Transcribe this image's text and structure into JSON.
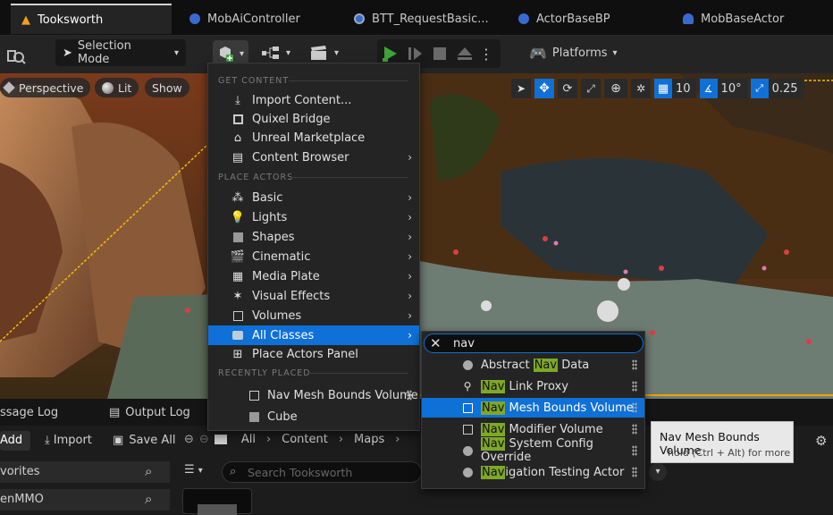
{
  "tabs": [
    {
      "label": "Tooksworth",
      "icon": "unreal-logo-icon"
    },
    {
      "label": "MobAiController",
      "icon": "blueprint-icon"
    },
    {
      "label": "BTT_RequestBasic...",
      "icon": "task-icon"
    },
    {
      "label": "ActorBaseBP",
      "icon": "blueprint-icon"
    },
    {
      "label": "MobBaseActor",
      "icon": "actor-icon"
    }
  ],
  "toolbar": {
    "selection_mode": "Selection Mode",
    "platforms": "Platforms"
  },
  "viewport": {
    "perspective": "Perspective",
    "lit": "Lit",
    "show": "Show",
    "grid_snap": "10",
    "rot_snap": "10°",
    "scale_snap": "0.25"
  },
  "menu": {
    "get_content_header": "GET CONTENT",
    "place_actors_header": "PLACE ACTORS",
    "recently_placed_header": "RECENTLY PLACED",
    "get_content": [
      "Import Content...",
      "Quixel Bridge",
      "Unreal Marketplace",
      "Content Browser"
    ],
    "place_actors": [
      "Basic",
      "Lights",
      "Shapes",
      "Cinematic",
      "Media Plate",
      "Visual Effects",
      "Volumes",
      "All Classes",
      "Place Actors Panel"
    ],
    "recent": [
      "Nav Mesh Bounds Volume",
      "Cube"
    ]
  },
  "submenu": {
    "search_value": "nav",
    "items": [
      {
        "pre": "Abstract ",
        "match": "Nav",
        "post": " Data"
      },
      {
        "pre": "",
        "match": "Nav",
        "post": " Link Proxy"
      },
      {
        "pre": "",
        "match": "Nav",
        "post": " Mesh Bounds Volume"
      },
      {
        "pre": "",
        "match": "Nav",
        "post": " Modifier Volume"
      },
      {
        "pre": "",
        "match": "Nav",
        "post": " System Config Override"
      },
      {
        "pre": "",
        "match": "Nav",
        "post": "igation Testing Actor"
      }
    ]
  },
  "tooltip": {
    "title": "Nav Mesh Bounds Volume",
    "hint": "hold (Ctrl + Alt) for more"
  },
  "bottom": {
    "message_log": "ssage Log",
    "output_log": "Output Log",
    "add": "Add",
    "import": "Import",
    "save_all": "Save All",
    "crumbs": [
      "All",
      "Content",
      "Maps"
    ],
    "favorites": "vorites",
    "project": "enMMO",
    "search_placeholder": "Search Tooksworth"
  },
  "colors": {
    "accent": "#0f70d7",
    "play": "#3fa33a",
    "match": "#7ea828"
  }
}
